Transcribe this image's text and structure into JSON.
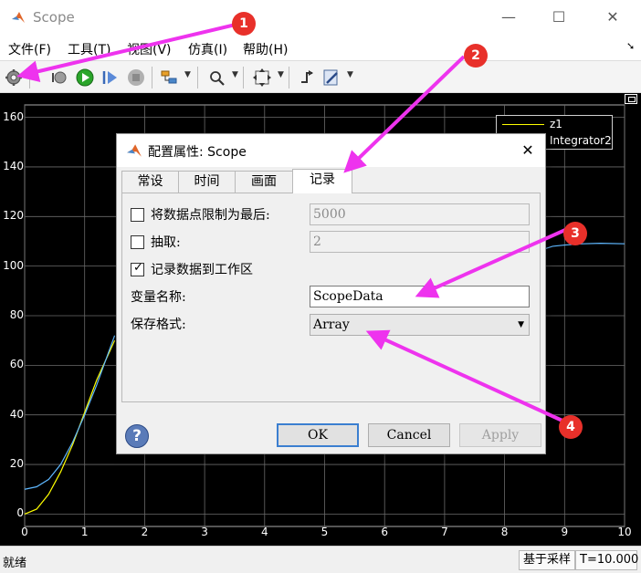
{
  "window": {
    "title": "Scope"
  },
  "menu": [
    {
      "label": "文件(F)"
    },
    {
      "label": "工具(T)"
    },
    {
      "label": "视图(V)"
    },
    {
      "label": "仿真(I)"
    },
    {
      "label": "帮助(H)"
    }
  ],
  "toolbar": {
    "icons": [
      "gear-icon",
      "step-back-icon",
      "run-icon",
      "step-forward-icon",
      "stop-icon",
      "highlight-icon",
      "zoom-icon",
      "fit-icon",
      "triggers-icon",
      "style-icon"
    ]
  },
  "plot": {
    "y_ticks": [
      "160",
      "140",
      "120",
      "100",
      "80",
      "60",
      "40",
      "20",
      "0"
    ],
    "x_ticks": [
      "0",
      "1",
      "2",
      "3",
      "4",
      "5",
      "6",
      "7",
      "8",
      "9",
      "10"
    ],
    "legend": [
      {
        "label": "z1",
        "color": "#ffff00"
      },
      {
        "label": "Integrator2",
        "color": "#5fb8ff"
      }
    ],
    "background": "#000000",
    "grid_color": "#6a6a6a"
  },
  "dialog": {
    "title": "配置属性: Scope",
    "tabs": [
      {
        "label": "常设",
        "active": false
      },
      {
        "label": "时间",
        "active": false
      },
      {
        "label": "画面",
        "active": false
      },
      {
        "label": "记录",
        "active": true
      }
    ],
    "limit_points": {
      "label": "将数据点限制为最后:",
      "checked": false,
      "value": "5000"
    },
    "decimation": {
      "label": "抽取:",
      "checked": false,
      "value": "2"
    },
    "log_to_workspace": {
      "label": "记录数据到工作区",
      "checked": true
    },
    "variable_name": {
      "label": "变量名称:",
      "value": "ScopeData"
    },
    "save_format": {
      "label": "保存格式:",
      "value": "Array"
    },
    "buttons": {
      "ok": "OK",
      "cancel": "Cancel",
      "apply": "Apply"
    },
    "help_glyph": "?"
  },
  "status": {
    "ready": "就绪",
    "mode": "基于采样",
    "time": "T=10.000"
  },
  "annotations": [
    "1",
    "2",
    "3",
    "4"
  ],
  "accent_color": "#ee33ee"
}
